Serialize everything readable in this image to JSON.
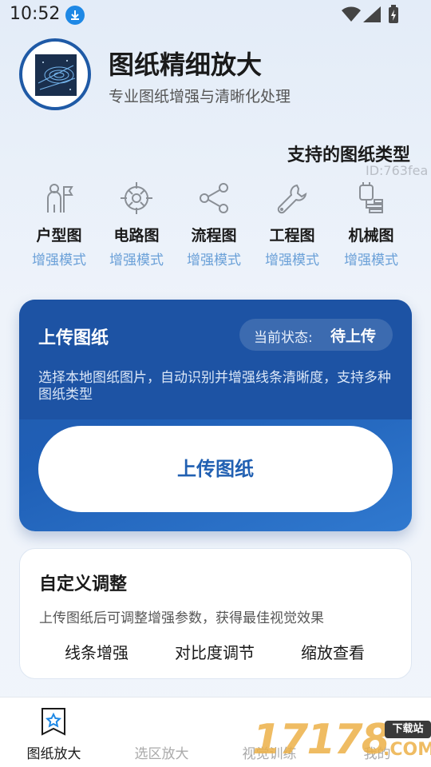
{
  "status_bar": {
    "time": "10:52",
    "icons": [
      "download-icon",
      "wifi-icon",
      "signal-icon",
      "battery-charging-icon"
    ]
  },
  "header": {
    "title": "图纸精细放大",
    "subtitle": "专业图纸增强与清晰化处理",
    "logo_icon": "blueprint-logo"
  },
  "drawing_types": {
    "title": "支持的图纸类型",
    "id_watermark": "ID:763fea",
    "items": [
      {
        "name": "户型图",
        "mode": "增强模式",
        "icon": "floorplan-icon"
      },
      {
        "name": "电路图",
        "mode": "增强模式",
        "icon": "circuit-icon"
      },
      {
        "name": "流程图",
        "mode": "增强模式",
        "icon": "share-flow-icon"
      },
      {
        "name": "工程图",
        "mode": "增强模式",
        "icon": "wrench-icon"
      },
      {
        "name": "机械图",
        "mode": "增强模式",
        "icon": "machine-icon"
      }
    ]
  },
  "upload_card": {
    "title": "上传图纸",
    "status_label": "当前状态:",
    "status_value": "待上传",
    "description": "选择本地图纸图片，自动识别并增强线条清晰度，支持多种图纸类型",
    "button_label": "上传图纸"
  },
  "custom_card": {
    "title": "自定义调整",
    "description": "上传图纸后可调整增强参数，获得最佳视觉效果",
    "options": [
      "线条增强",
      "对比度调节",
      "缩放查看"
    ]
  },
  "bottom_nav": {
    "items": [
      {
        "label": "图纸放大",
        "active": true,
        "icon": "drawing-star-icon"
      },
      {
        "label": "选区放大",
        "active": false
      },
      {
        "label": "视觉训练",
        "active": false
      },
      {
        "label": "我的",
        "active": false
      }
    ]
  },
  "watermark": {
    "digits": "17178",
    "tag": "下载站",
    "suffix": ".COM"
  },
  "colors": {
    "accent": "#2160b2",
    "card_blue": "#1d53a4",
    "mode_text": "#6aa0d8"
  }
}
